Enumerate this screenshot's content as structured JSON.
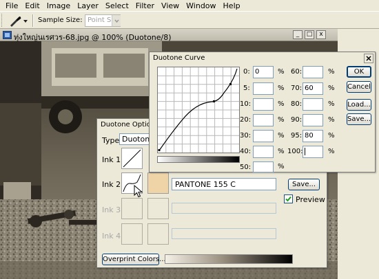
{
  "menu": [
    "File",
    "Edit",
    "Image",
    "Layer",
    "Select",
    "Filter",
    "View",
    "Window",
    "Help"
  ],
  "options_bar": {
    "sample_size_label": "Sample Size:",
    "sample_size_value": "Point Sample"
  },
  "document": {
    "title": "ทุ่งใหญ่นเรศวร-68.jpg @ 100% (Duotone/8)",
    "controls": [
      "_",
      "□",
      "x"
    ]
  },
  "duotone_options": {
    "title": "Duotone Options",
    "type_label": "Type:",
    "type_value": "Duotone",
    "ink1_label": "Ink 1:",
    "ink2_label": "Ink 2:",
    "ink3_label": "Ink 3:",
    "ink4_label": "Ink 4:",
    "ink2_name": "PANTONE 155 C",
    "ink2_color": "#efd4a8",
    "save_label": "Save...",
    "preview_label": "Preview",
    "preview_checked": true,
    "overprint_label": "Overprint Colors..."
  },
  "duotone_curve": {
    "title": "Duotone Curve",
    "ok_label": "OK",
    "cancel_label": "Cancel",
    "load_label": "Load...",
    "save_label": "Save...",
    "percent_sign": "%",
    "left_entries": [
      {
        "label": "0:",
        "value": "0"
      },
      {
        "label": "5:",
        "value": ""
      },
      {
        "label": "10:",
        "value": ""
      },
      {
        "label": "20:",
        "value": ""
      },
      {
        "label": "30:",
        "value": ""
      },
      {
        "label": "40:",
        "value": ""
      },
      {
        "label": "50:",
        "value": ""
      }
    ],
    "right_entries": [
      {
        "label": "60:",
        "value": ""
      },
      {
        "label": "70:",
        "value": "60"
      },
      {
        "label": "80:",
        "value": ""
      },
      {
        "label": "90:",
        "value": ""
      },
      {
        "label": "95:",
        "value": "80"
      },
      {
        "label": "100:",
        "value": ""
      }
    ]
  }
}
